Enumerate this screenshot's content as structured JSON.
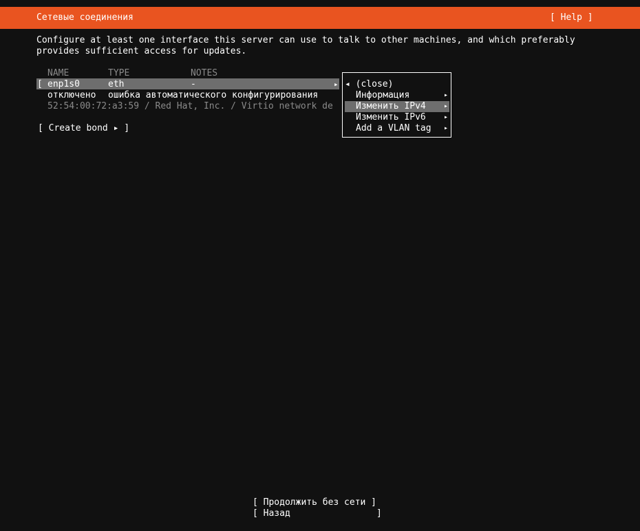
{
  "header": {
    "title": "Сетевые соединения",
    "help": "[ Help ]"
  },
  "description": [
    "Configure at least one interface this server can use to talk to other machines, and which preferably",
    "provides sufficient access for updates."
  ],
  "table": {
    "headers": [
      "NAME",
      "TYPE",
      "NOTES"
    ],
    "row": {
      "bracket": "[",
      "name": "enp1s0",
      "type": "eth",
      "notes": "-",
      "arrow": "▸"
    },
    "status": {
      "state": "отключено",
      "message": "ошибка автоматического конфигурирования"
    },
    "detail": "52:54:00:72:a3:59 / Red Hat, Inc. / Virtio network de"
  },
  "create_bond": "[ Create bond ▸ ]",
  "menu": {
    "items": [
      {
        "label": "◂ (close)",
        "arrow": ""
      },
      {
        "label": "Информация",
        "arrow": "▸"
      },
      {
        "label": "Изменить IPv4",
        "arrow": "▸"
      },
      {
        "label": "Изменить IPv6",
        "arrow": "▸"
      },
      {
        "label": "Add a VLAN tag",
        "arrow": "▸"
      }
    ]
  },
  "footer": {
    "continue": "[ Продолжить без сети ]",
    "back": "[ Назад                ]"
  }
}
